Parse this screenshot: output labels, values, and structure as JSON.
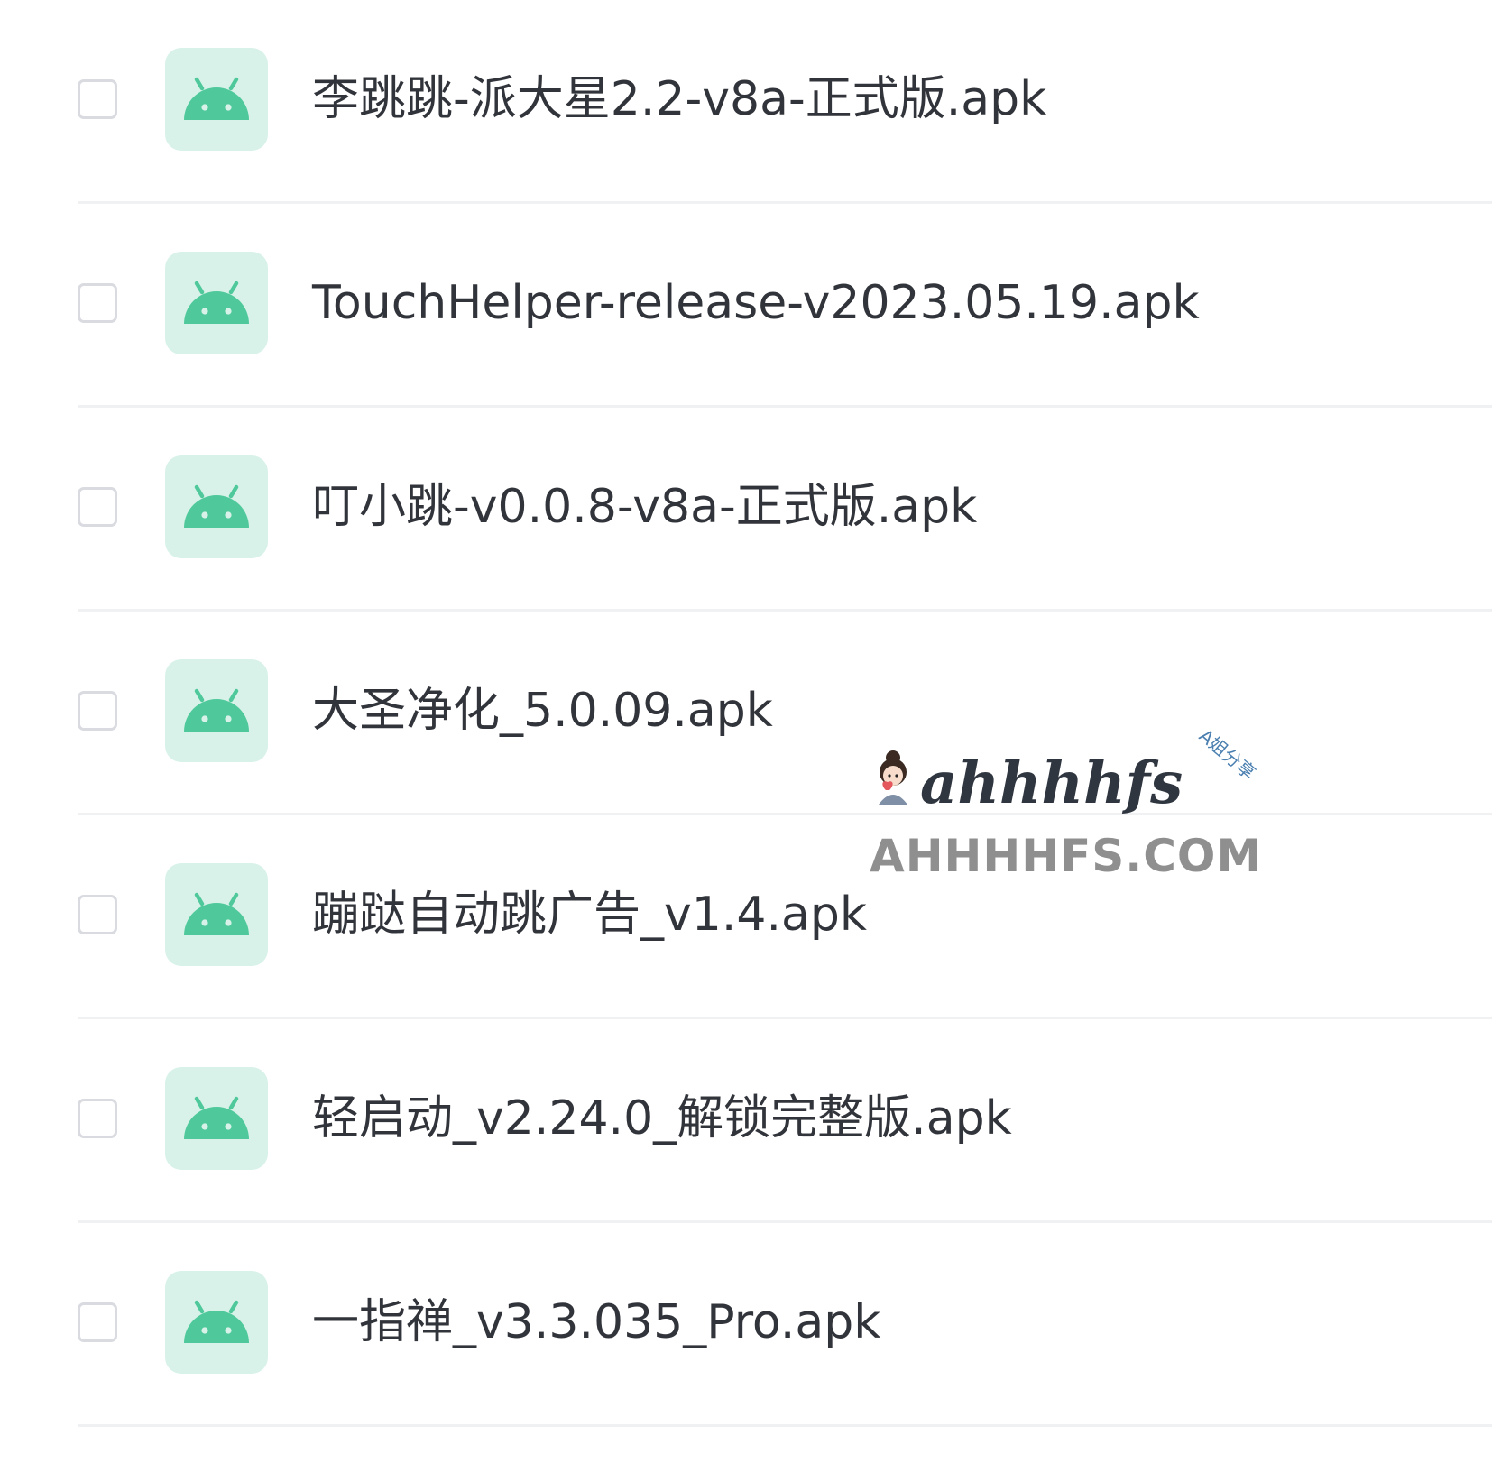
{
  "file_list": {
    "items": [
      {
        "name": "李跳跳-派大星2.2-v8a-正式版.apk",
        "icon": "android-icon",
        "checked": false
      },
      {
        "name": "TouchHelper-release-v2023.05.19.apk",
        "icon": "android-icon",
        "checked": false
      },
      {
        "name": "叮小跳-v0.0.8-v8a-正式版.apk",
        "icon": "android-icon",
        "checked": false
      },
      {
        "name": "大圣净化_5.0.09.apk",
        "icon": "android-icon",
        "checked": false
      },
      {
        "name": "蹦跶自动跳广告_v1.4.apk",
        "icon": "android-icon",
        "checked": false
      },
      {
        "name": "轻启动_v2.24.0_解锁完整版.apk",
        "icon": "android-icon",
        "checked": false
      },
      {
        "name": "一指禅_v3.3.035_Pro.apk",
        "icon": "android-icon",
        "checked": false
      }
    ]
  },
  "watermark": {
    "logo_text": "ahhhhfs",
    "tagline": "A姐分享",
    "domain": "AHHHHFS.COM"
  },
  "colors": {
    "icon_bg": "#d8f2e9",
    "android_green": "#4fc99b",
    "text": "#31343a",
    "divider": "#f0f1f3",
    "checkbox_border": "#d9dbe0"
  }
}
